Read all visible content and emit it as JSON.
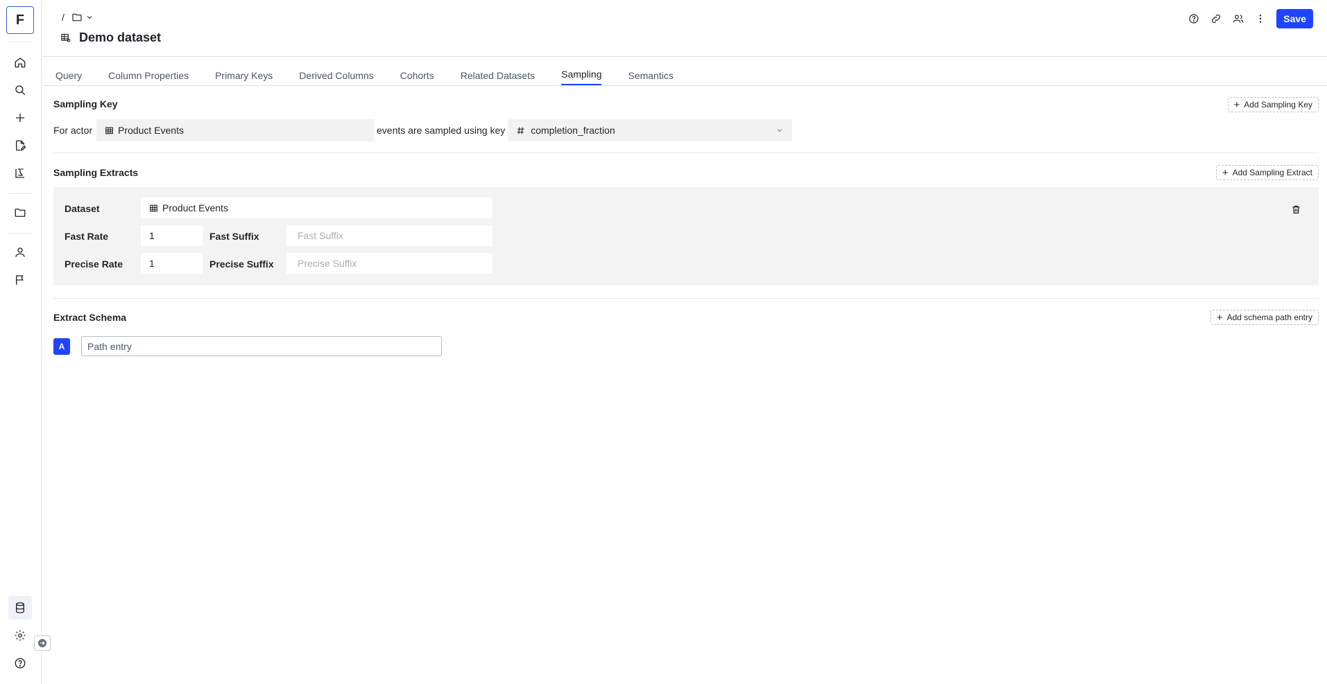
{
  "rail": {
    "logo_letter": "F",
    "items": [
      "home-icon",
      "search-icon",
      "plus-icon",
      "edit-doc-icon",
      "lab-icon",
      "folder-icon",
      "user-icon",
      "flag-icon"
    ],
    "bottom": [
      "database-icon",
      "gear-icon",
      "help-icon"
    ]
  },
  "header": {
    "breadcrumb_sep": "/",
    "title": "Demo dataset",
    "save_label": "Save"
  },
  "tabs": [
    {
      "label": "Query",
      "active": false
    },
    {
      "label": "Column Properties",
      "active": false
    },
    {
      "label": "Primary Keys",
      "active": false
    },
    {
      "label": "Derived Columns",
      "active": false
    },
    {
      "label": "Cohorts",
      "active": false
    },
    {
      "label": "Related Datasets",
      "active": false
    },
    {
      "label": "Sampling",
      "active": true
    },
    {
      "label": "Semantics",
      "active": false
    }
  ],
  "sampling_key": {
    "title": "Sampling Key",
    "add_label": "Add Sampling Key",
    "for_actor_label": "For actor",
    "actor_value": "Product Events",
    "middle_text": "events are sampled using key",
    "key_value": "completion_fraction"
  },
  "sampling_extracts": {
    "title": "Sampling Extracts",
    "add_label": "Add Sampling Extract",
    "dataset_label": "Dataset",
    "dataset_value": "Product Events",
    "fast_rate_label": "Fast Rate",
    "fast_rate_value": "1",
    "fast_suffix_label": "Fast Suffix",
    "fast_suffix_placeholder": "Fast Suffix",
    "precise_rate_label": "Precise Rate",
    "precise_rate_value": "1",
    "precise_suffix_label": "Precise Suffix",
    "precise_suffix_placeholder": "Precise Suffix"
  },
  "extract_schema": {
    "title": "Extract Schema",
    "add_label": "Add schema path entry",
    "badge": "A",
    "path_placeholder": "Path entry"
  }
}
